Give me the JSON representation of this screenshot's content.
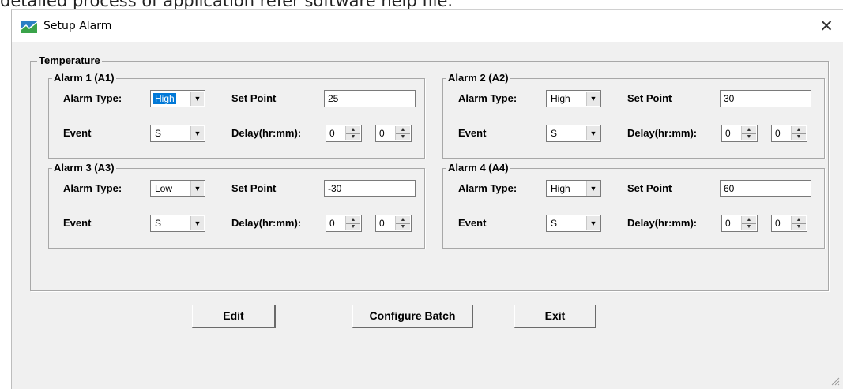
{
  "page_caption": "detailed process of application refer software help file.",
  "window": {
    "title": "Setup Alarm",
    "close_glyph": "✕",
    "icon": "app-chart-icon"
  },
  "temperature": {
    "label": "Temperature",
    "field_labels": {
      "alarm_type": "Alarm Type:",
      "set_point": "Set Point",
      "event": "Event",
      "delay": "Delay(hr:mm):"
    },
    "alarms": [
      {
        "title": "Alarm 1 (A1)",
        "type": "High",
        "set_point": "25",
        "event": "S",
        "delay_hr": "0",
        "delay_min": "0"
      },
      {
        "title": "Alarm 2 (A2)",
        "type": "High",
        "set_point": "30",
        "event": "S",
        "delay_hr": "0",
        "delay_min": "0"
      },
      {
        "title": "Alarm 3 (A3)",
        "type": "Low",
        "set_point": "-30",
        "event": "S",
        "delay_hr": "0",
        "delay_min": "0"
      },
      {
        "title": "Alarm 4 (A4)",
        "type": "High",
        "set_point": "60",
        "event": "S",
        "delay_hr": "0",
        "delay_min": "0"
      }
    ]
  },
  "buttons": {
    "edit": "Edit",
    "configure_batch": "Configure Batch",
    "exit": "Exit"
  },
  "colors": {
    "selection": "#0078d7",
    "window_bg": "#f0f0f0"
  }
}
